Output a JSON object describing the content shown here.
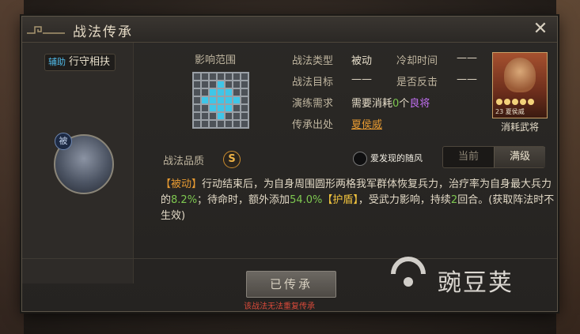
{
  "header": {
    "title": "战法传承",
    "close_glyph": "✕"
  },
  "left": {
    "role_sub": "辅助",
    "skill_name": "行守相扶",
    "passive_badge": "被"
  },
  "range": {
    "label": "影响范围"
  },
  "info": {
    "type_label": "战法类型",
    "type_value": "被动",
    "cooldown_label": "冷却时间",
    "cooldown_value": "——",
    "target_label": "战法目标",
    "target_value": "——",
    "counter_label": "是否反击",
    "counter_value": "——",
    "drill_label": "演练需求",
    "drill_value_prefix": "需要消耗",
    "drill_count": "0",
    "drill_unit": "个",
    "drill_value_suffix": "良将",
    "source_label": "传承出处",
    "source_value": "夏侯威"
  },
  "hero": {
    "card_level": "23 夏侯威",
    "caption": "消耗武将"
  },
  "quality": {
    "label": "战法品质",
    "grade": "S"
  },
  "watermark": {
    "text": "爱发现的随风"
  },
  "toggle": {
    "current": "当前",
    "max": "满级"
  },
  "description": {
    "tag": "【被动】",
    "part1": "行动结束后，为自身周围圆形两格我军群体恢复兵力，治疗率为自身最大兵力的",
    "value1": "8.2%",
    "part2": "；待命时，额外添加",
    "value2": "54.0%",
    "tag2": "【护盾】",
    "part3": "，受武力影响，持续",
    "value3": "2",
    "part4": "回合。(获取阵法时不生效)"
  },
  "action": {
    "button": "已传承",
    "warning": "该战法无法重复传承"
  },
  "site": {
    "name": "豌豆荚"
  },
  "colors": {
    "accent_blue": "#3fc6e8",
    "accent_orange": "#e69a32",
    "accent_purple": "#c06ef0",
    "warning_red": "#d84a3a"
  }
}
